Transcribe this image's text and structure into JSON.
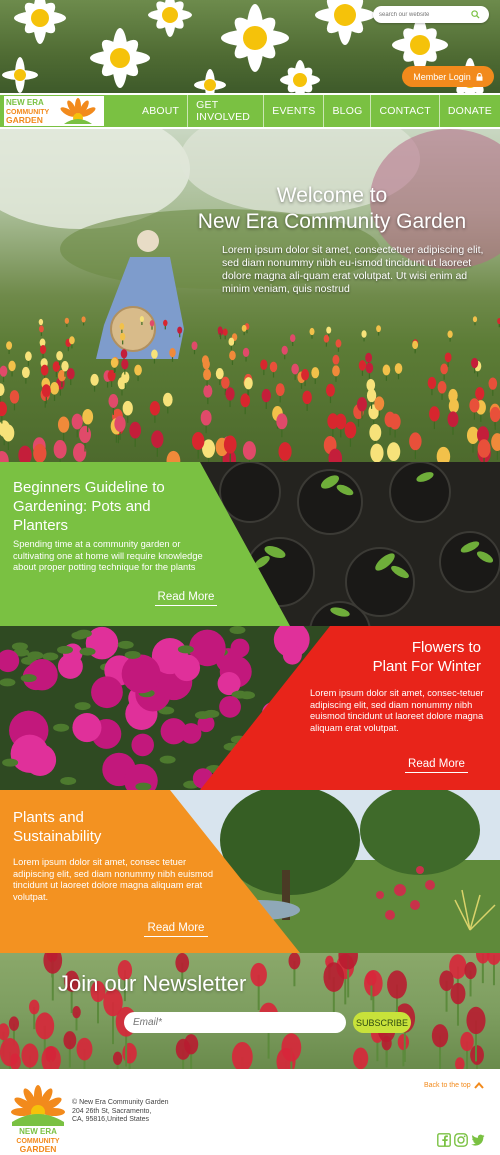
{
  "header": {
    "search_placeholder": "search our website",
    "member_login": "Member Login"
  },
  "logo": {
    "line1": "NEW ERA",
    "line2": "COMMUNITY",
    "line3": "GARDEN"
  },
  "nav": {
    "items": [
      "ABOUT",
      "GET INVOLVED",
      "EVENTS",
      "BLOG",
      "CONTACT",
      "DONATE"
    ]
  },
  "hero": {
    "title_line1": "Welcome to",
    "title_line2": "New Era Community Garden",
    "body": "Lorem ipsum dolor sit amet, consectetuer adipiscing elit, sed diam nonummy nibh eu-ismod tincidunt ut laoreet dolore magna ali-quam erat volutpat. Ut wisi enim ad minim veniam, quis nostrud",
    "slides": 5
  },
  "blocks": [
    {
      "title": "Beginners Guideline to Gardening: Pots and Planters",
      "body": "Spending time at a community garden or cultivating one at home will require knowledge about proper potting technique for the plants",
      "link": "Read More",
      "color": "#7ac142"
    },
    {
      "title_line1": "Flowers to",
      "title_line2": "Plant For Winter",
      "body": "Lorem ipsum dolor sit amet, consec-tetuer adipiscing elit, sed diam nonummy nibh euismod tincidunt ut laoreet dolore magna aliquam erat volutpat.",
      "link": "Read More",
      "color": "#e8241a"
    },
    {
      "title": "Plants and Sustainability",
      "body": "Lorem ipsum dolor sit amet, consec tetuer adipiscing elit, sed diam nonummy nibh euismod tincidunt ut laoreet dolore magna aliquam erat volutpat.",
      "link": "Read More",
      "color": "#f39221"
    }
  ],
  "newsletter": {
    "title": "Join our Newsletter",
    "email_placeholder": "Email*",
    "subscribe": "SUBSCRIBE"
  },
  "footer": {
    "copyright": "© New Era Community Garden",
    "address1": "204 26th St, Sacramento,",
    "address2": "CA, 95816,United States",
    "back_to_top": "Back to the top",
    "socials": [
      "facebook-icon",
      "instagram-icon",
      "twitter-icon"
    ]
  },
  "colors": {
    "green": "#7ac142",
    "orange": "#f39221",
    "red": "#e8241a",
    "lime": "#c8e23a"
  }
}
